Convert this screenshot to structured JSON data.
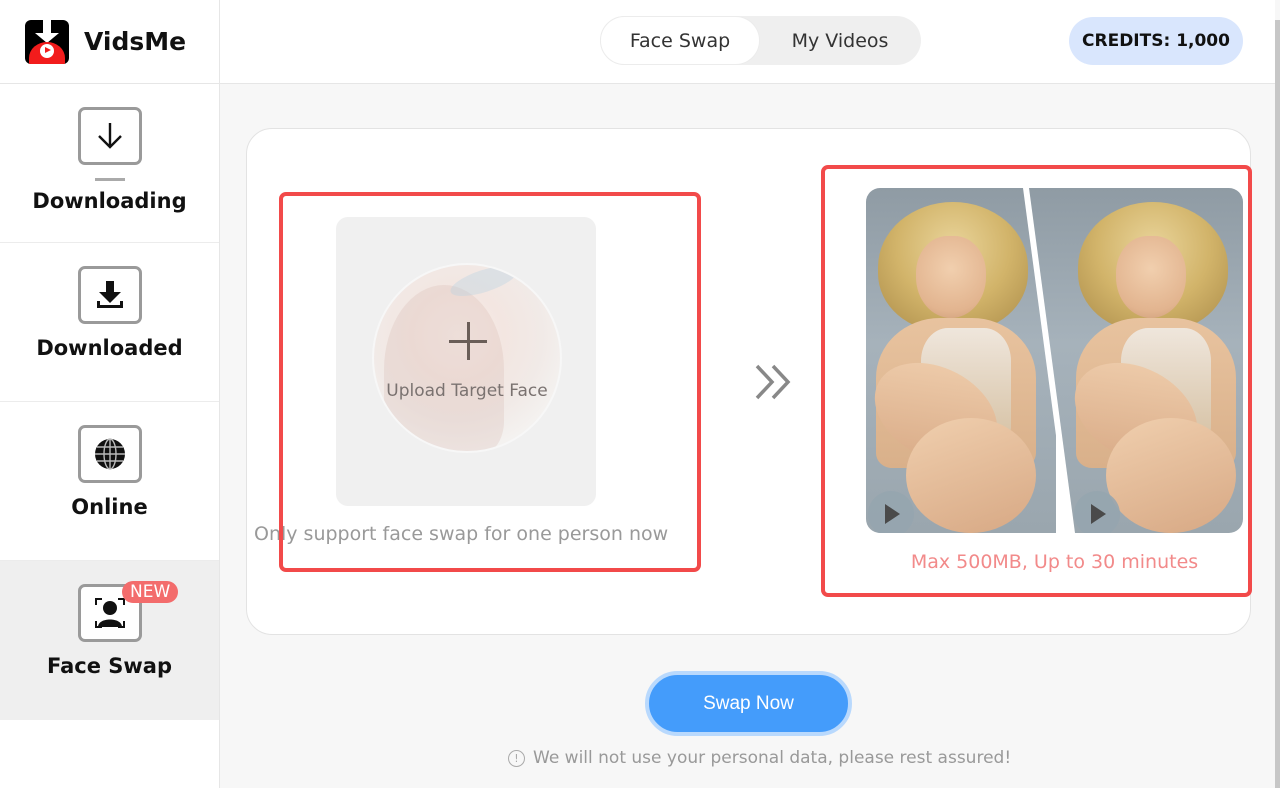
{
  "app": {
    "name": "VidsMe",
    "logo_icon": "download-play-logo-icon"
  },
  "sidebar": {
    "items": [
      {
        "label": "Downloading",
        "icon": "download-arrow-icon",
        "active": false
      },
      {
        "label": "Downloaded",
        "icon": "downloaded-tray-icon",
        "active": false
      },
      {
        "label": "Online",
        "icon": "globe-icon",
        "active": false
      },
      {
        "label": "Face Swap",
        "icon": "face-scan-icon",
        "active": true,
        "badge": "NEW"
      }
    ]
  },
  "header": {
    "tabs": [
      {
        "label": "Face Swap",
        "active": true
      },
      {
        "label": "My Videos",
        "active": false
      }
    ],
    "credits": "CREDITS: 1,000"
  },
  "main": {
    "upload": {
      "label": "Upload Target Face",
      "hint": "Only support face swap for one person now"
    },
    "arrows_icon": "double-chevron-right-icon",
    "preview": {
      "hint": "Max 500MB, Up to 30 minutes"
    },
    "swap_button": "Swap Now",
    "privacy_note": "We will not use your personal data, please rest assured!",
    "privacy_icon_glyph": "!"
  },
  "colors": {
    "highlight_border": "#f24a4a",
    "primary_button": "#449cfb",
    "credits_bg": "#d9e6fd",
    "badge_new": "#f36c6c",
    "preview_hint": "#f28a8a"
  }
}
